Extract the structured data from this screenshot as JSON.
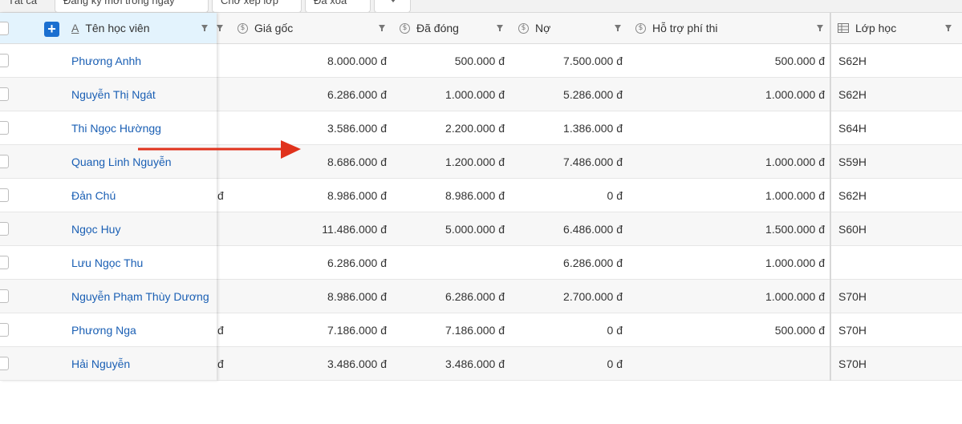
{
  "tabs": [
    "Tất cả",
    "Đăng ký mới trong ngày",
    "Chờ xếp lớp",
    "Đã xóa"
  ],
  "headers": {
    "name": "Tên học viên",
    "gia_goc": "Giá gốc",
    "da_dong": "Đã đóng",
    "no": "Nợ",
    "ho_tro": "Hỗ trợ phí thi",
    "lop_hoc": "Lớp học"
  },
  "rows": [
    {
      "name": "Phương Anhh",
      "peek": "",
      "gia_goc": "8.000.000 đ",
      "da_dong": "500.000 đ",
      "no": "7.500.000 đ",
      "ho_tro": "500.000 đ",
      "lop": "S62H"
    },
    {
      "name": "Nguyễn Thị Ngát",
      "peek": "",
      "gia_goc": "6.286.000 đ",
      "da_dong": "1.000.000 đ",
      "no": "5.286.000 đ",
      "ho_tro": "1.000.000 đ",
      "lop": "S62H"
    },
    {
      "name": "Thi Ngọc Hườngg",
      "peek": "",
      "gia_goc": "3.586.000 đ",
      "da_dong": "2.200.000 đ",
      "no": "1.386.000 đ",
      "ho_tro": "",
      "lop": "S64H"
    },
    {
      "name": "Quang Linh Nguyễn",
      "peek": "",
      "gia_goc": "8.686.000 đ",
      "da_dong": "1.200.000 đ",
      "no": "7.486.000 đ",
      "ho_tro": "1.000.000 đ",
      "lop": "S59H"
    },
    {
      "name": "Đản Chú",
      "peek": "đ",
      "gia_goc": "8.986.000 đ",
      "da_dong": "8.986.000 đ",
      "no": "0 đ",
      "ho_tro": "1.000.000 đ",
      "lop": "S62H"
    },
    {
      "name": "Ngọc Huy",
      "peek": "",
      "gia_goc": "11.486.000 đ",
      "da_dong": "5.000.000 đ",
      "no": "6.486.000 đ",
      "ho_tro": "1.500.000 đ",
      "lop": "S60H"
    },
    {
      "name": "Lưu Ngọc Thu",
      "peek": "",
      "gia_goc": "6.286.000 đ",
      "da_dong": "",
      "no": "6.286.000 đ",
      "ho_tro": "1.000.000 đ",
      "lop": ""
    },
    {
      "name": "Nguyễn Phạm Thùy Dương",
      "peek": "",
      "gia_goc": "8.986.000 đ",
      "da_dong": "6.286.000 đ",
      "no": "2.700.000 đ",
      "ho_tro": "1.000.000 đ",
      "lop": "S70H"
    },
    {
      "name": "Phương Nga",
      "peek": "đ",
      "gia_goc": "7.186.000 đ",
      "da_dong": "7.186.000 đ",
      "no": "0 đ",
      "ho_tro": "500.000 đ",
      "lop": "S70H"
    },
    {
      "name": "Hải Nguyễn",
      "peek": "đ",
      "gia_goc": "3.486.000 đ",
      "da_dong": "3.486.000 đ",
      "no": "0 đ",
      "ho_tro": "",
      "lop": "S70H"
    }
  ],
  "icons": {
    "add": "+",
    "currency": "$",
    "text_field": "A"
  },
  "colors": {
    "accent": "#1b6fd0",
    "link": "#1a5fb4",
    "arrow": "#e0321c",
    "frozen_header": "#e3f3fd"
  }
}
